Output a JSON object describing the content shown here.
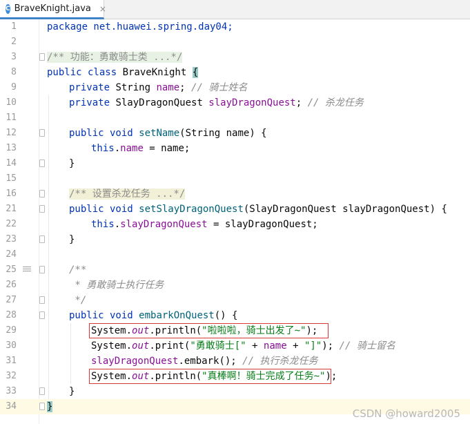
{
  "tab": {
    "icon_letter": "C",
    "label": "BraveKnight.java",
    "close": "×"
  },
  "watermark": "CSDN @howard2005",
  "lines": {
    "l1": {
      "n": "1",
      "t": [
        "package net.huawei.spring.day04;"
      ]
    },
    "l2": {
      "n": "2"
    },
    "l3": {
      "n": "3",
      "t": [
        "/** 功能：勇敢骑士类 ...*/"
      ]
    },
    "l8": {
      "n": "8",
      "t": [
        "public class ",
        "BraveKnight ",
        "{"
      ]
    },
    "l9": {
      "n": "9",
      "t": [
        "private ",
        "String ",
        "name",
        "; ",
        "// 骑士姓名"
      ]
    },
    "l10": {
      "n": "10",
      "t": [
        "private ",
        "SlayDragonQuest ",
        "slayDragonQuest",
        "; ",
        "// 杀龙任务"
      ]
    },
    "l11": {
      "n": "11"
    },
    "l12": {
      "n": "12",
      "t": [
        "public void ",
        "setName",
        "(String name) {"
      ]
    },
    "l13": {
      "n": "13",
      "t": [
        "this",
        ".",
        "name",
        " = name;"
      ]
    },
    "l14": {
      "n": "14",
      "t": [
        "}"
      ]
    },
    "l15": {
      "n": "15"
    },
    "l16": {
      "n": "16",
      "t": [
        "/** 设置杀龙任务 ...*/"
      ]
    },
    "l21": {
      "n": "21",
      "t": [
        "public void ",
        "setSlayDragonQuest",
        "(SlayDragonQuest slayDragonQuest) {"
      ]
    },
    "l22": {
      "n": "22",
      "t": [
        "this",
        ".",
        "slayDragonQuest",
        " = slayDragonQuest;"
      ]
    },
    "l23": {
      "n": "23",
      "t": [
        "}"
      ]
    },
    "l24": {
      "n": "24"
    },
    "l25": {
      "n": "25",
      "t": [
        "/**"
      ]
    },
    "l26": {
      "n": "26",
      "t": [
        " * 勇敢骑士执行任务"
      ]
    },
    "l27": {
      "n": "27",
      "t": [
        " */"
      ]
    },
    "l28": {
      "n": "28",
      "t": [
        "public void ",
        "embarkOnQuest",
        "() {"
      ]
    },
    "l29": {
      "n": "29",
      "t": [
        "System.",
        "out",
        ".println(",
        "\"啦啦啦，骑士出发了~\"",
        ");"
      ]
    },
    "l30": {
      "n": "30",
      "t": [
        "System.",
        "out",
        ".print(",
        "\"勇敢骑士[\"",
        " + ",
        "name",
        " + ",
        "\"]\"",
        "); ",
        "// 骑士留名"
      ]
    },
    "l31": {
      "n": "31",
      "t": [
        "slayDragonQuest",
        ".embark(); ",
        "// 执行杀龙任务"
      ]
    },
    "l32": {
      "n": "32",
      "t": [
        "System.",
        "out",
        ".println(",
        "\"真棒啊！骑士完成了任务~\"",
        ");"
      ]
    },
    "l33": {
      "n": "33",
      "t": [
        "}"
      ]
    },
    "l34": {
      "n": "34",
      "t": [
        "}"
      ]
    }
  }
}
